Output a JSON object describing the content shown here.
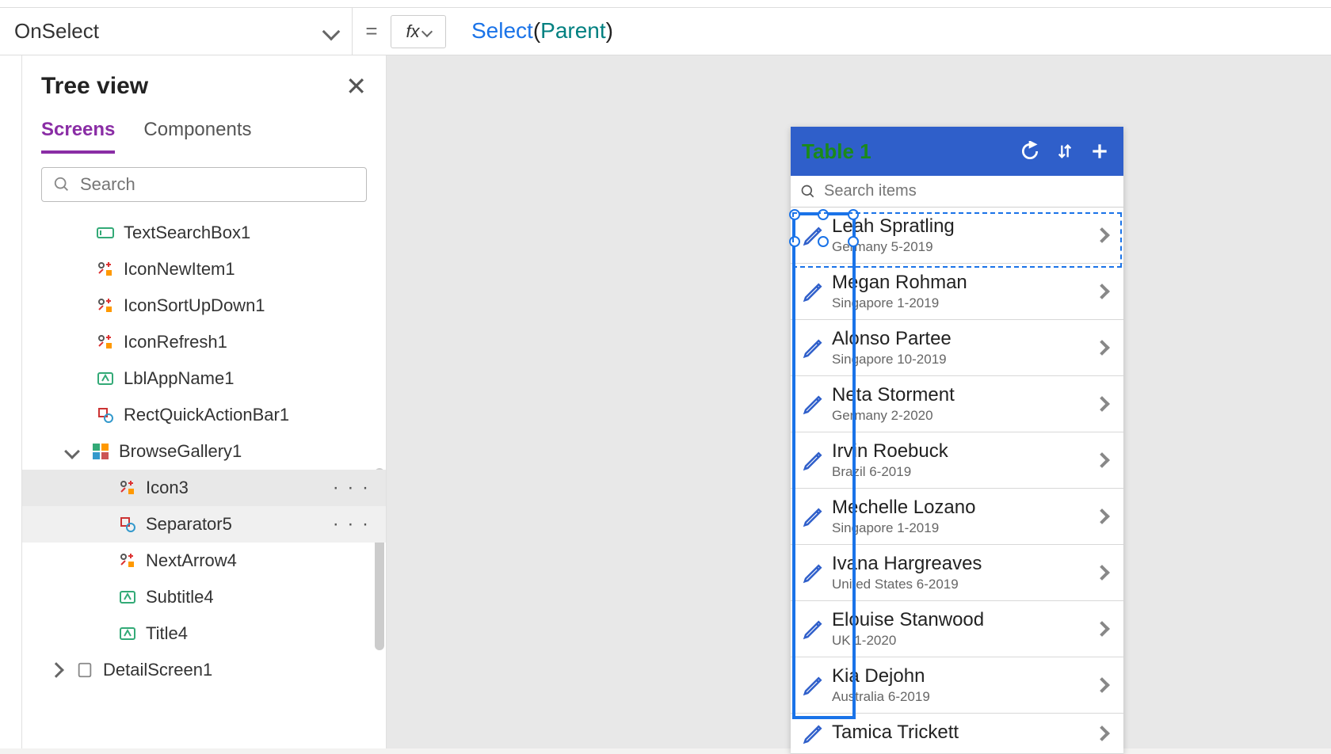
{
  "topbar": {
    "property": "OnSelect",
    "fx": "fx",
    "equals": "=",
    "formula_select": "Select",
    "formula_open": "(",
    "formula_arg": "Parent",
    "formula_close": ")"
  },
  "tree": {
    "title": "Tree view",
    "tabs": {
      "screens": "Screens",
      "components": "Components"
    },
    "search_placeholder": "Search",
    "items": [
      {
        "label": "TextSearchBox1",
        "icon": "textbox"
      },
      {
        "label": "IconNewItem1",
        "icon": "iconctrl"
      },
      {
        "label": "IconSortUpDown1",
        "icon": "iconctrl"
      },
      {
        "label": "IconRefresh1",
        "icon": "iconctrl"
      },
      {
        "label": "LblAppName1",
        "icon": "label"
      },
      {
        "label": "RectQuickActionBar1",
        "icon": "shape"
      },
      {
        "label": "BrowseGallery1",
        "icon": "gallery"
      }
    ],
    "children": [
      {
        "label": "Icon3",
        "icon": "iconctrl",
        "selected": true
      },
      {
        "label": "Separator5",
        "icon": "shape",
        "hovered": true
      },
      {
        "label": "NextArrow4",
        "icon": "iconctrl"
      },
      {
        "label": "Subtitle4",
        "icon": "label"
      },
      {
        "label": "Title4",
        "icon": "label"
      }
    ],
    "detail_screen": "DetailScreen1",
    "more": "· · ·"
  },
  "phone": {
    "title": "Table 1",
    "search_placeholder": "Search items",
    "rows": [
      {
        "title": "Leah Spratling",
        "sub": "Germany 5-2019"
      },
      {
        "title": "Megan Rohman",
        "sub": "Singapore 1-2019"
      },
      {
        "title": "Alonso Partee",
        "sub": "Singapore 10-2019"
      },
      {
        "title": "Neta Storment",
        "sub": "Germany 2-2020"
      },
      {
        "title": "Irvin Roebuck",
        "sub": "Brazil 6-2019"
      },
      {
        "title": "Mechelle Lozano",
        "sub": "Singapore 1-2019"
      },
      {
        "title": "Ivana Hargreaves",
        "sub": "United States 6-2019"
      },
      {
        "title": "Elouise Stanwood",
        "sub": "UK 1-2020"
      },
      {
        "title": "Kia Dejohn",
        "sub": "Australia 6-2019"
      },
      {
        "title": "Tamica Trickett",
        "sub": ""
      }
    ]
  }
}
